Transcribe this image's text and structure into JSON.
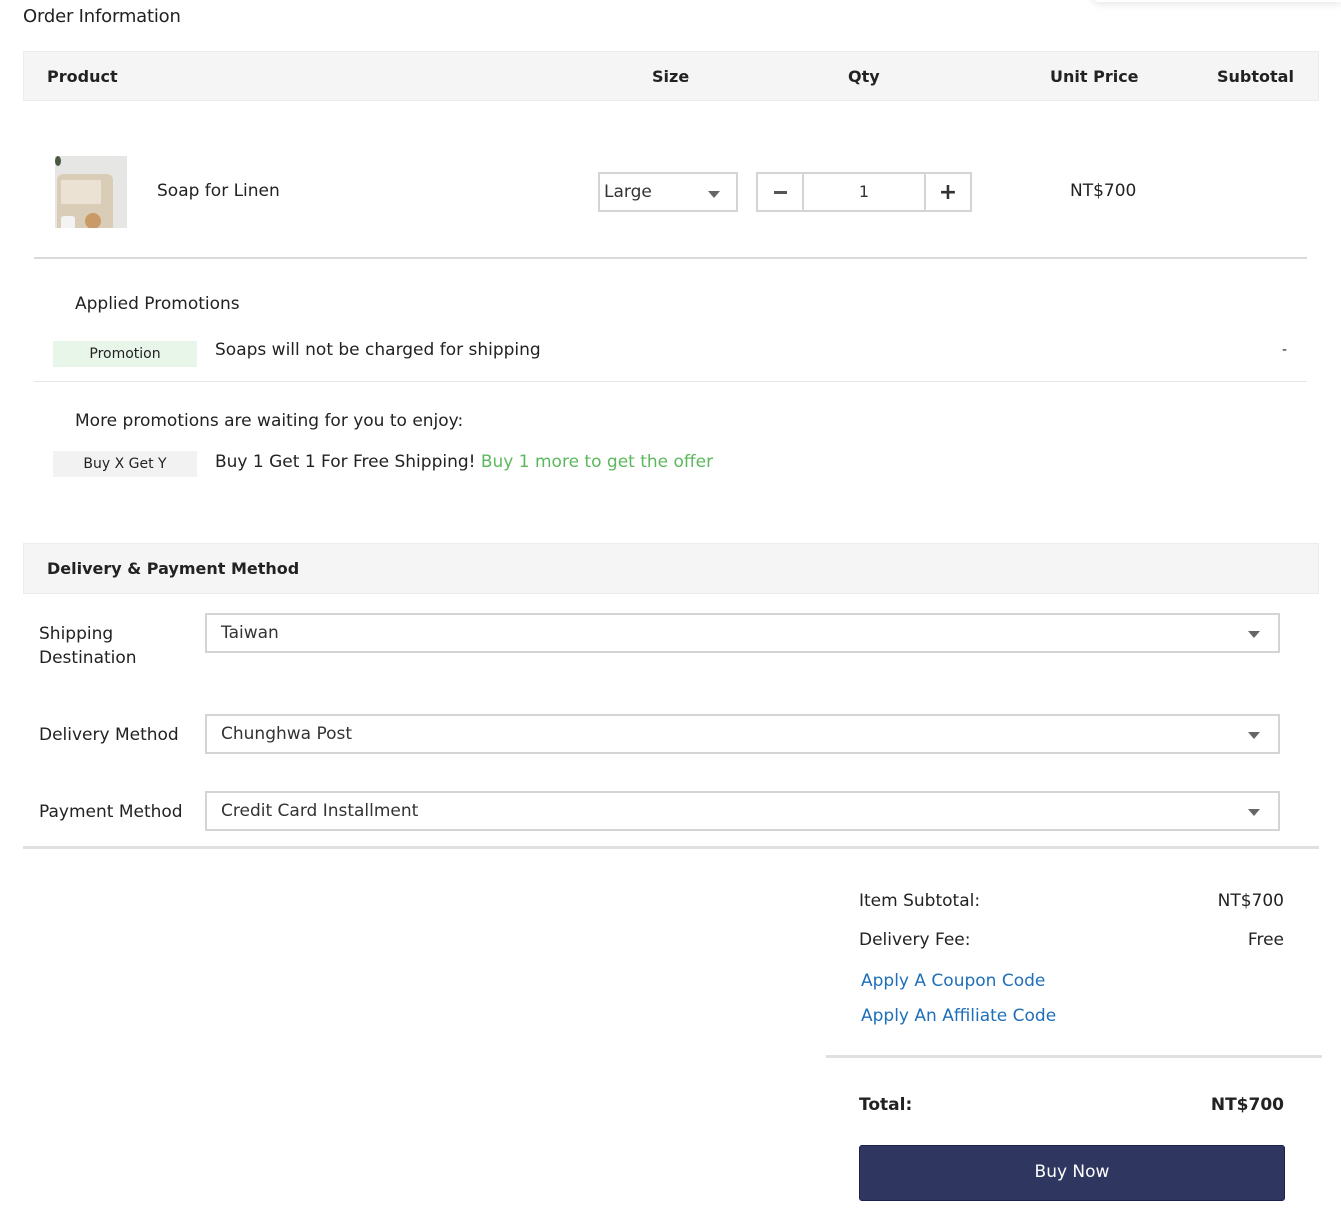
{
  "order": {
    "title": "Order Information",
    "columns": {
      "product": "Product",
      "size": "Size",
      "qty": "Qty",
      "unit_price": "Unit Price",
      "subtotal": "Subtotal"
    },
    "items": [
      {
        "name": "Soap for Linen",
        "image": "soap-product-photo",
        "size": "Large",
        "qty": "1",
        "unit_price": "NT$700",
        "subtotal": ""
      }
    ],
    "qty_controls": {
      "minus_icon": "minus-icon",
      "plus_icon": "plus-icon",
      "plus_glyph": "+"
    }
  },
  "promotions": {
    "applied_heading": "Applied Promotions",
    "applied": [
      {
        "tag": "Promotion",
        "text": "Soaps will not be charged for shipping",
        "amount": "-"
      }
    ],
    "more_heading": "More promotions are waiting for you to enjoy:",
    "more": [
      {
        "tag": "Buy X Get Y",
        "text": "Buy 1 Get 1 For Free Shipping!",
        "cta": "Buy 1 more to get the offer"
      }
    ]
  },
  "delivery": {
    "title": "Delivery & Payment Method",
    "fields": [
      {
        "label": "Shipping Destination",
        "value": "Taiwan"
      },
      {
        "label": "Delivery Method",
        "value": "Chunghwa Post"
      },
      {
        "label": "Payment Method",
        "value": "Credit Card Installment"
      }
    ]
  },
  "summary": {
    "item_subtotal_label": "Item Subtotal:",
    "item_subtotal_value": "NT$700",
    "delivery_fee_label": "Delivery Fee:",
    "delivery_fee_value": "Free",
    "coupon_link": "Apply A Coupon Code",
    "affiliate_link": "Apply An Affiliate Code",
    "total_label": "Total:",
    "total_value": "NT$700",
    "buy_button": "Buy Now"
  },
  "colors": {
    "primary_button": "#2f3761",
    "link": "#1f6fb8",
    "promo_green": "#5cb85c",
    "promo_tag_bg": "#e8f5e9",
    "header_bg": "#f5f5f5"
  }
}
